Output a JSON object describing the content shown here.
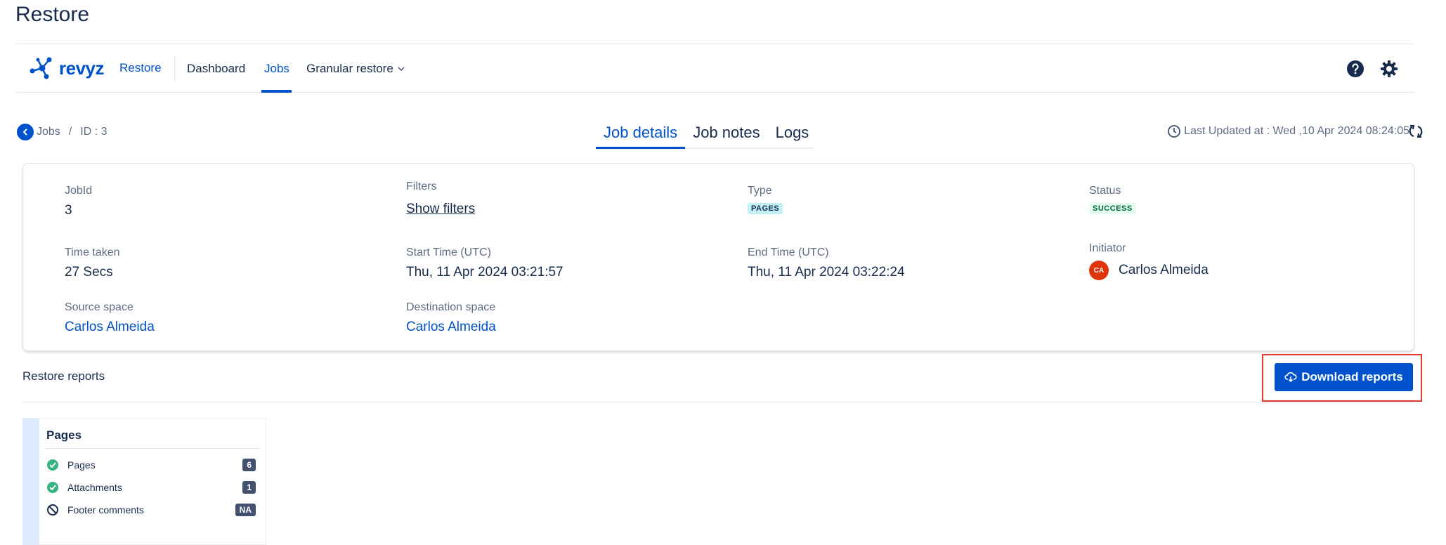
{
  "page": {
    "title": "Restore"
  },
  "nav": {
    "logo_text": "revyz",
    "app_label": "Restore",
    "items": [
      "Dashboard",
      "Jobs",
      "Granular restore"
    ],
    "active": "Jobs"
  },
  "breadcrumb": {
    "parent": "Jobs",
    "separator": "/",
    "current": "ID : 3"
  },
  "tabs": [
    "Job details",
    "Job notes",
    "Logs"
  ],
  "active_tab": "Job details",
  "last_updated": "Last Updated at : Wed ,10 Apr 2024 08:24:05",
  "details": {
    "job_id": {
      "label": "JobId",
      "value": "3"
    },
    "filters": {
      "label": "Filters",
      "value": "Show filters"
    },
    "type": {
      "label": "Type",
      "value": "PAGES"
    },
    "status": {
      "label": "Status",
      "value": "SUCCESS"
    },
    "time_taken": {
      "label": "Time taken",
      "value": "27 Secs"
    },
    "start_time": {
      "label": "Start Time (UTC)",
      "value": "Thu, 11 Apr 2024 03:21:57"
    },
    "end_time": {
      "label": "End Time (UTC)",
      "value": "Thu, 11 Apr 2024 03:22:24"
    },
    "initiator": {
      "label": "Initiator",
      "initials": "CA",
      "value": "Carlos Almeida"
    },
    "source_space": {
      "label": "Source space",
      "value": "Carlos Almeida"
    },
    "destination_space": {
      "label": "Destination space",
      "value": "Carlos Almeida"
    }
  },
  "reports": {
    "header": "Restore reports",
    "download_label": "Download reports",
    "card": {
      "title": "Pages",
      "rows": [
        {
          "label": "Pages",
          "count": "6",
          "status": "success"
        },
        {
          "label": "Attachments",
          "count": "1",
          "status": "success"
        },
        {
          "label": "Footer comments",
          "count": "NA",
          "status": "blocked"
        }
      ]
    }
  },
  "colors": {
    "primary": "#0052cc",
    "highlight": "#e5382f",
    "avatar": "#de350b",
    "success": "#36b37e"
  }
}
